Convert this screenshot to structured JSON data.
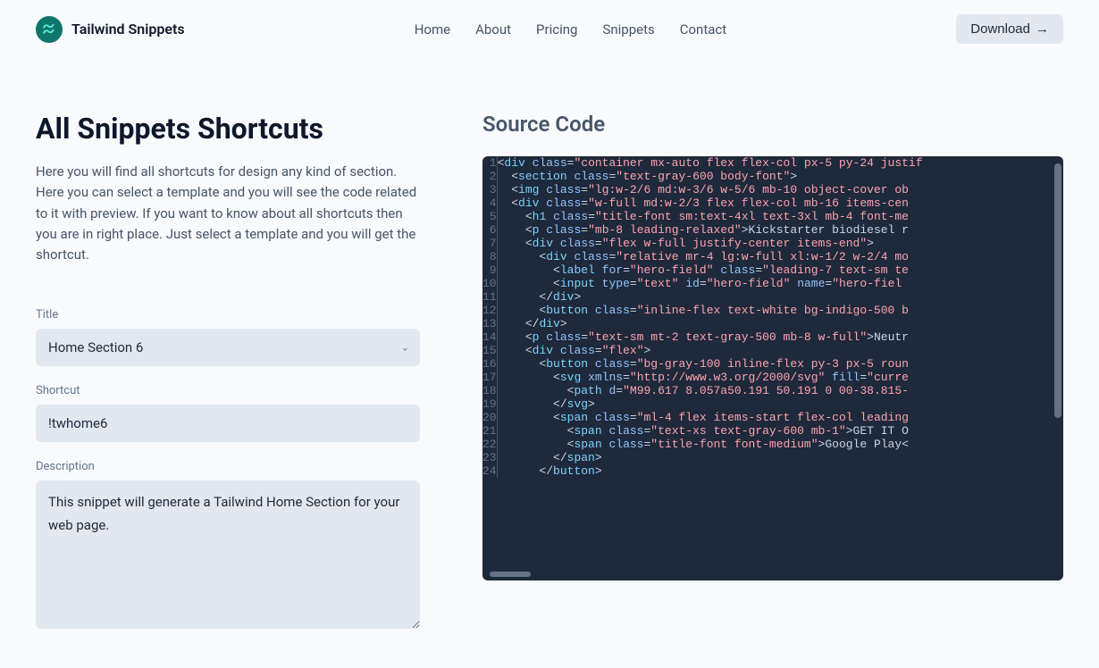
{
  "brand": {
    "name": "Tailwind Snippets"
  },
  "nav": {
    "links": [
      "Home",
      "About",
      "Pricing",
      "Snippets",
      "Contact"
    ],
    "download": "Download"
  },
  "page": {
    "title": "All Snippets Shortcuts",
    "description": "Here you will find all shortcuts for design any kind of section. Here you can select a template and you will see the code related to it with preview. If you want to know about all shortcuts then you are in right place. Just select a template and you will get the shortcut."
  },
  "form": {
    "title_label": "Title",
    "title_value": "Home Section 6",
    "shortcut_label": "Shortcut",
    "shortcut_value": "!twhome6",
    "description_label": "Description",
    "description_value": "This snippet will generate a Tailwind Home Section for your web page."
  },
  "source": {
    "title": "Source Code",
    "lines": [
      {
        "indent": 0,
        "tokens": [
          [
            "angle",
            "<"
          ],
          [
            "tag",
            "div"
          ],
          [
            "sp",
            " "
          ],
          [
            "attr",
            "class"
          ],
          [
            "eq",
            "="
          ],
          [
            "val",
            "\"container mx-auto flex flex-col px-5 py-24 justif"
          ]
        ]
      },
      {
        "indent": 1,
        "tokens": [
          [
            "angle",
            "<"
          ],
          [
            "tag",
            "section"
          ],
          [
            "sp",
            " "
          ],
          [
            "attr",
            "class"
          ],
          [
            "eq",
            "="
          ],
          [
            "val",
            "\"text-gray-600 body-font\""
          ],
          [
            "angle",
            ">"
          ]
        ]
      },
      {
        "indent": 1,
        "tokens": [
          [
            "angle",
            "<"
          ],
          [
            "tag",
            "img"
          ],
          [
            "sp",
            " "
          ],
          [
            "attr",
            "class"
          ],
          [
            "eq",
            "="
          ],
          [
            "val",
            "\"lg:w-2/6 md:w-3/6 w-5/6 mb-10 object-cover ob"
          ]
        ]
      },
      {
        "indent": 1,
        "tokens": [
          [
            "angle",
            "<"
          ],
          [
            "tag",
            "div"
          ],
          [
            "sp",
            " "
          ],
          [
            "attr",
            "class"
          ],
          [
            "eq",
            "="
          ],
          [
            "val",
            "\"w-full md:w-2/3 flex flex-col mb-16 items-cen"
          ]
        ]
      },
      {
        "indent": 2,
        "tokens": [
          [
            "angle",
            "<"
          ],
          [
            "tag",
            "h1"
          ],
          [
            "sp",
            " "
          ],
          [
            "attr",
            "class"
          ],
          [
            "eq",
            "="
          ],
          [
            "val",
            "\"title-font sm:text-4xl text-3xl mb-4 font-me"
          ]
        ]
      },
      {
        "indent": 2,
        "tokens": [
          [
            "angle",
            "<"
          ],
          [
            "tag",
            "p"
          ],
          [
            "sp",
            " "
          ],
          [
            "attr",
            "class"
          ],
          [
            "eq",
            "="
          ],
          [
            "val",
            "\"mb-8 leading-relaxed\""
          ],
          [
            "angle",
            ">"
          ],
          [
            "txt",
            "Kickstarter biodiesel r"
          ]
        ]
      },
      {
        "indent": 2,
        "tokens": [
          [
            "angle",
            "<"
          ],
          [
            "tag",
            "div"
          ],
          [
            "sp",
            " "
          ],
          [
            "attr",
            "class"
          ],
          [
            "eq",
            "="
          ],
          [
            "val",
            "\"flex w-full justify-center items-end\""
          ],
          [
            "angle",
            ">"
          ]
        ]
      },
      {
        "indent": 3,
        "tokens": [
          [
            "angle",
            "<"
          ],
          [
            "tag",
            "div"
          ],
          [
            "sp",
            " "
          ],
          [
            "attr",
            "class"
          ],
          [
            "eq",
            "="
          ],
          [
            "val",
            "\"relative mr-4 lg:w-full xl:w-1/2 w-2/4 mo"
          ]
        ]
      },
      {
        "indent": 4,
        "tokens": [
          [
            "angle",
            "<"
          ],
          [
            "tag",
            "label"
          ],
          [
            "sp",
            " "
          ],
          [
            "attr",
            "for"
          ],
          [
            "eq",
            "="
          ],
          [
            "val",
            "\"hero-field\""
          ],
          [
            "sp",
            " "
          ],
          [
            "attr",
            "class"
          ],
          [
            "eq",
            "="
          ],
          [
            "val",
            "\"leading-7 text-sm te"
          ]
        ]
      },
      {
        "indent": 4,
        "tokens": [
          [
            "angle",
            "<"
          ],
          [
            "tag",
            "input"
          ],
          [
            "sp",
            " "
          ],
          [
            "attr",
            "type"
          ],
          [
            "eq",
            "="
          ],
          [
            "val",
            "\"text\""
          ],
          [
            "sp",
            " "
          ],
          [
            "attr",
            "id"
          ],
          [
            "eq",
            "="
          ],
          [
            "val",
            "\"hero-field\""
          ],
          [
            "sp",
            " "
          ],
          [
            "attr",
            "name"
          ],
          [
            "eq",
            "="
          ],
          [
            "val",
            "\"hero-fiel"
          ]
        ]
      },
      {
        "indent": 3,
        "tokens": [
          [
            "angle",
            "</"
          ],
          [
            "tag",
            "div"
          ],
          [
            "angle",
            ">"
          ]
        ]
      },
      {
        "indent": 3,
        "tokens": [
          [
            "angle",
            "<"
          ],
          [
            "tag",
            "button"
          ],
          [
            "sp",
            " "
          ],
          [
            "attr",
            "class"
          ],
          [
            "eq",
            "="
          ],
          [
            "val",
            "\"inline-flex text-white bg-indigo-500 b"
          ]
        ]
      },
      {
        "indent": 2,
        "tokens": [
          [
            "angle",
            "</"
          ],
          [
            "tag",
            "div"
          ],
          [
            "angle",
            ">"
          ]
        ]
      },
      {
        "indent": 2,
        "tokens": [
          [
            "angle",
            "<"
          ],
          [
            "tag",
            "p"
          ],
          [
            "sp",
            " "
          ],
          [
            "attr",
            "class"
          ],
          [
            "eq",
            "="
          ],
          [
            "val",
            "\"text-sm mt-2 text-gray-500 mb-8 w-full\""
          ],
          [
            "angle",
            ">"
          ],
          [
            "txt",
            "Neutr"
          ]
        ]
      },
      {
        "indent": 2,
        "tokens": [
          [
            "angle",
            "<"
          ],
          [
            "tag",
            "div"
          ],
          [
            "sp",
            " "
          ],
          [
            "attr",
            "class"
          ],
          [
            "eq",
            "="
          ],
          [
            "val",
            "\"flex\""
          ],
          [
            "angle",
            ">"
          ]
        ]
      },
      {
        "indent": 3,
        "tokens": [
          [
            "angle",
            "<"
          ],
          [
            "tag",
            "button"
          ],
          [
            "sp",
            " "
          ],
          [
            "attr",
            "class"
          ],
          [
            "eq",
            "="
          ],
          [
            "val",
            "\"bg-gray-100 inline-flex py-3 px-5 roun"
          ]
        ]
      },
      {
        "indent": 4,
        "tokens": [
          [
            "angle",
            "<"
          ],
          [
            "tag",
            "svg"
          ],
          [
            "sp",
            " "
          ],
          [
            "attr",
            "xmlns"
          ],
          [
            "eq",
            "="
          ],
          [
            "val",
            "\"http://www.w3.org/2000/svg\""
          ],
          [
            "sp",
            " "
          ],
          [
            "attr",
            "fill"
          ],
          [
            "eq",
            "="
          ],
          [
            "val",
            "\"curre"
          ]
        ]
      },
      {
        "indent": 5,
        "tokens": [
          [
            "angle",
            "<"
          ],
          [
            "tag",
            "path"
          ],
          [
            "sp",
            " "
          ],
          [
            "attr",
            "d"
          ],
          [
            "eq",
            "="
          ],
          [
            "val",
            "\"M99.617 8.057a50.191 50.191 0 00-38.815-"
          ]
        ]
      },
      {
        "indent": 4,
        "tokens": [
          [
            "angle",
            "</"
          ],
          [
            "tag",
            "svg"
          ],
          [
            "angle",
            ">"
          ]
        ]
      },
      {
        "indent": 4,
        "tokens": [
          [
            "angle",
            "<"
          ],
          [
            "tag",
            "span"
          ],
          [
            "sp",
            " "
          ],
          [
            "attr",
            "class"
          ],
          [
            "eq",
            "="
          ],
          [
            "val",
            "\"ml-4 flex items-start flex-col leading"
          ]
        ]
      },
      {
        "indent": 5,
        "tokens": [
          [
            "angle",
            "<"
          ],
          [
            "tag",
            "span"
          ],
          [
            "sp",
            " "
          ],
          [
            "attr",
            "class"
          ],
          [
            "eq",
            "="
          ],
          [
            "val",
            "\"text-xs text-gray-600 mb-1\""
          ],
          [
            "angle",
            ">"
          ],
          [
            "txt",
            "GET IT O"
          ]
        ]
      },
      {
        "indent": 5,
        "tokens": [
          [
            "angle",
            "<"
          ],
          [
            "tag",
            "span"
          ],
          [
            "sp",
            " "
          ],
          [
            "attr",
            "class"
          ],
          [
            "eq",
            "="
          ],
          [
            "val",
            "\"title-font font-medium\""
          ],
          [
            "angle",
            ">"
          ],
          [
            "txt",
            "Google Play"
          ],
          [
            "angle",
            "<"
          ]
        ]
      },
      {
        "indent": 4,
        "tokens": [
          [
            "angle",
            "</"
          ],
          [
            "tag",
            "span"
          ],
          [
            "angle",
            ">"
          ]
        ]
      },
      {
        "indent": 3,
        "tokens": [
          [
            "angle",
            "</"
          ],
          [
            "tag",
            "button"
          ],
          [
            "angle",
            ">"
          ]
        ]
      }
    ]
  }
}
